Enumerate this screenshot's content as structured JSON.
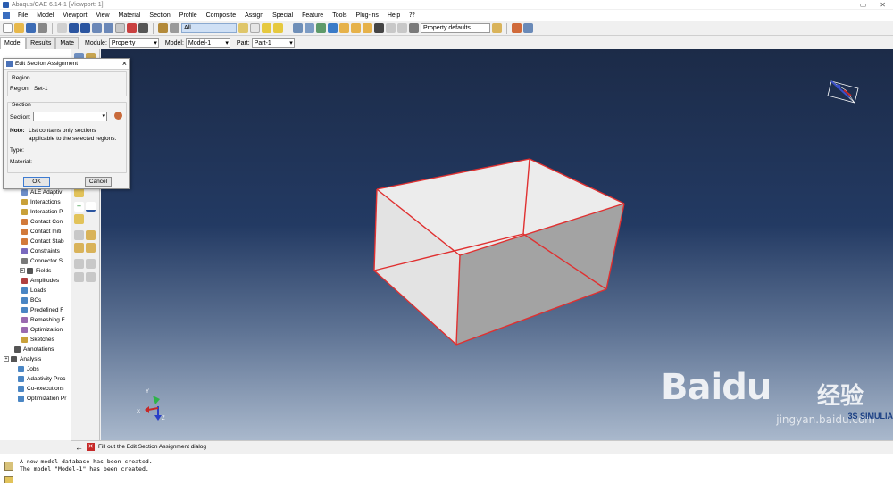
{
  "window": {
    "title": "Abaqus/CAE 6.14-1 [Viewport: 1]",
    "controls": [
      "▭",
      "✕"
    ]
  },
  "menubar": {
    "items": [
      "File",
      "Model",
      "Viewport",
      "View",
      "Material",
      "Section",
      "Profile",
      "Composite",
      "Assign",
      "Special",
      "Feature",
      "Tools",
      "Plug-ins",
      "Help",
      "⁇"
    ]
  },
  "toolbar": {
    "filter_value": "All",
    "render_style": "Property defaults"
  },
  "context": {
    "tabs": [
      "Model",
      "Results",
      "Mate"
    ],
    "module_label": "Module:",
    "module_value": "Property",
    "model_label": "Model:",
    "model_value": "Model-1",
    "part_label": "Part:",
    "part_value": "Part-1"
  },
  "tree": {
    "items": [
      {
        "label": "ALE Adaptiv",
        "color": "#6e8fc9"
      },
      {
        "label": "Interactions",
        "color": "#c9a13a"
      },
      {
        "label": "Interaction P",
        "color": "#c9a13a"
      },
      {
        "label": "Contact Con",
        "color": "#d27a3b"
      },
      {
        "label": "Contact Initi",
        "color": "#d27a3b"
      },
      {
        "label": "Contact Stab",
        "color": "#d27a3b"
      },
      {
        "label": "Constraints",
        "color": "#7a6abf"
      },
      {
        "label": "Connector S",
        "color": "#7a7a7a"
      },
      {
        "label": "Fields",
        "color": "#555555"
      },
      {
        "label": "Amplitudes",
        "color": "#b04040"
      },
      {
        "label": "Loads",
        "color": "#4a86c4"
      },
      {
        "label": "BCs",
        "color": "#4a86c4"
      },
      {
        "label": "Predefined F",
        "color": "#4a86c4"
      },
      {
        "label": "Remeshing F",
        "color": "#9a6ab0"
      },
      {
        "label": "Optimization",
        "color": "#9a6ab0"
      },
      {
        "label": "Sketches",
        "color": "#c9a13a"
      },
      {
        "label": "Annotations",
        "color": "#555555"
      },
      {
        "label": "Analysis",
        "color": "#555555"
      },
      {
        "label": "Jobs",
        "color": "#4a86c4"
      },
      {
        "label": "Adaptivity Proc",
        "color": "#4a86c4"
      },
      {
        "label": "Co-executions",
        "color": "#4a86c4"
      },
      {
        "label": "Optimization Pr",
        "color": "#4a86c4"
      }
    ]
  },
  "dialog": {
    "title": "Edit Section Assignment",
    "region_group": "Region",
    "region_label": "Region:",
    "region_value": "Set-1",
    "section_group": "Section",
    "section_label": "Section:",
    "section_value": "",
    "note_label": "Note:",
    "note_text_1": "List contains only sections",
    "note_text_2": "applicable to the selected regions.",
    "type_label": "Type:",
    "material_label": "Material:",
    "ok_label": "OK",
    "cancel_label": "Cancel"
  },
  "prompt": {
    "text": "Fill out the Edit Section Assignment dialog"
  },
  "messages": {
    "lines": [
      "A new model database has been created.",
      "The model \"Model-1\" has been created."
    ]
  },
  "triad": {
    "x": "X",
    "y": "Y",
    "z": "Z"
  },
  "watermark": {
    "logo": "Bai",
    "logo_end": "du",
    "cn": "经验",
    "url": "jingyan.baidu.com",
    "simulia": "3S SIMULIA"
  },
  "colors": {
    "viewport_top": "#1c2b48",
    "viewport_bottom": "#a9b8cc",
    "part_edge": "#e03030",
    "part_face_light": "#eeeeee",
    "part_face_dark": "#9e9e9e"
  }
}
